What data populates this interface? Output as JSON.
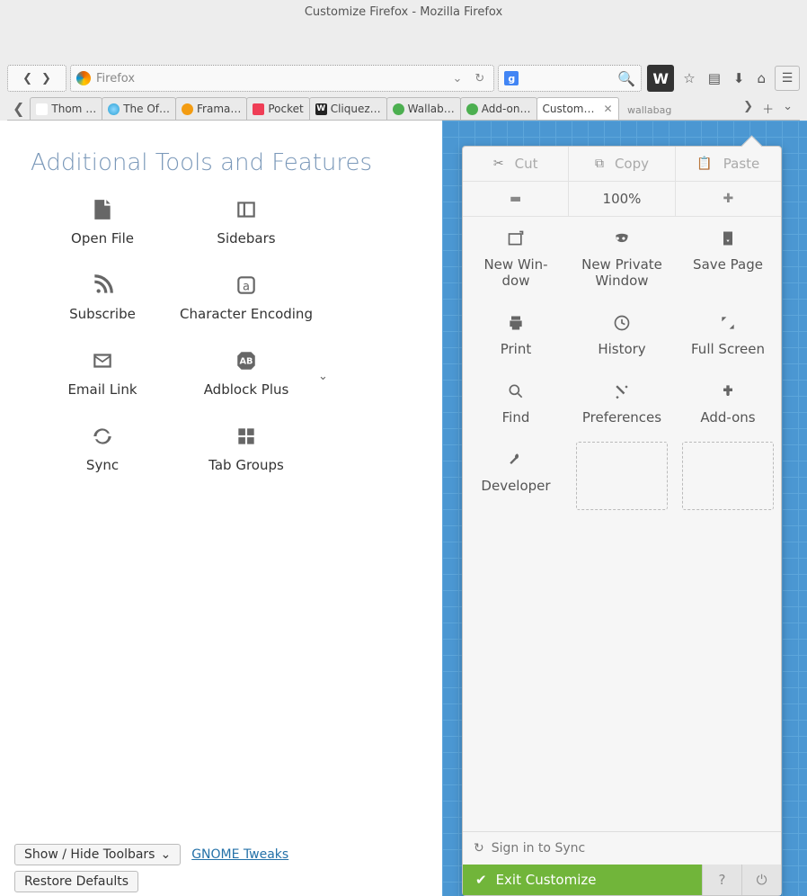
{
  "title": "Customize Firefox - Mozilla Firefox",
  "urlbar_placeholder": "Firefox",
  "walla_overlay": "wallabag",
  "toolbar_icons": [
    "star-icon",
    "list-icon",
    "download-icon",
    "home-icon"
  ],
  "tabs": [
    {
      "label": "Thom …",
      "cls": "thom"
    },
    {
      "label": "The Of…",
      "cls": "off"
    },
    {
      "label": "Frama…",
      "cls": "frama"
    },
    {
      "label": "Pocket",
      "cls": "pocket"
    },
    {
      "label": "Cliquez…",
      "cls": "cliquez",
      "initial": "W"
    },
    {
      "label": "Wallab…",
      "cls": "wallab"
    },
    {
      "label": "Add-on…",
      "cls": "addons"
    },
    {
      "label": "Custom…",
      "active": true
    }
  ],
  "left_heading": "Additional Tools and Features",
  "tools": [
    {
      "icon": "openfile",
      "label": "Open File"
    },
    {
      "icon": "sidebars",
      "label": "Sidebars"
    },
    {
      "icon": "subscribe",
      "label": "Subscribe"
    },
    {
      "icon": "charenc",
      "label": "Character Encoding"
    },
    {
      "icon": "emaillink",
      "label": "Email Link"
    },
    {
      "icon": "adblock",
      "label": "Adblock Plus",
      "chevron": true
    },
    {
      "icon": "sync",
      "label": "Sync"
    },
    {
      "icon": "tabgroups",
      "label": "Tab Groups"
    }
  ],
  "show_hide": "Show / Hide Toolbars",
  "restore_defaults": "Restore Defaults",
  "gnome_tweaks": "GNOME Tweaks",
  "panel_edit": {
    "cut": "Cut",
    "copy": "Copy",
    "paste": "Paste"
  },
  "panel_zoom": {
    "level": "100%"
  },
  "panel_items": [
    {
      "icon": "newwin",
      "label": "New Win-\ndow"
    },
    {
      "icon": "private",
      "label": "New Private\nWindow"
    },
    {
      "icon": "save",
      "label": "Save Page"
    },
    {
      "icon": "print",
      "label": "Print"
    },
    {
      "icon": "history",
      "label": "History"
    },
    {
      "icon": "fullscreen",
      "label": "Full Screen"
    },
    {
      "icon": "find",
      "label": "Find"
    },
    {
      "icon": "prefs",
      "label": "Preferences"
    },
    {
      "icon": "addons",
      "label": "Add-ons"
    },
    {
      "icon": "dev",
      "label": "Developer"
    }
  ],
  "signin": "Sign in to Sync",
  "exit": "Exit Customize"
}
